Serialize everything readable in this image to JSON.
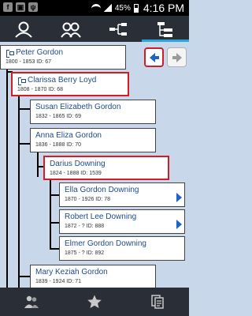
{
  "status_bar": {
    "battery": "45%",
    "time": "4:16 PM",
    "notification_icons": [
      "facebook-icon",
      "image-icon",
      "usb-icon"
    ]
  },
  "tabs": [
    {
      "icon": "person-icon",
      "active": false
    },
    {
      "icon": "family-icon",
      "active": false
    },
    {
      "icon": "pedigree-icon",
      "active": false
    },
    {
      "icon": "descendants-icon",
      "active": true
    }
  ],
  "nav": {
    "back_icon": "arrow-left-icon",
    "forward_icon": "arrow-right-icon"
  },
  "people": [
    {
      "name": "Peter Gordon",
      "meta": "1800 - 1853  ID: 67",
      "tree_icon": true,
      "selected": false,
      "expandable": false
    },
    {
      "name": "Clarissa Berry Loyd",
      "meta": "1808 - 1870  ID: 68",
      "tree_icon": true,
      "selected": true,
      "expandable": false
    },
    {
      "name": "Susan Elizabeth Gordon",
      "meta": "1832 - 1865  ID: 69",
      "tree_icon": false,
      "selected": false,
      "expandable": false
    },
    {
      "name": "Anna Eliza Gordon",
      "meta": "1836 - 1888  ID: 70",
      "tree_icon": false,
      "selected": false,
      "expandable": false
    },
    {
      "name": "Darius Downing",
      "meta": "1824 - 1888  ID: 1539",
      "tree_icon": false,
      "selected": true,
      "expandable": false
    },
    {
      "name": "Ella Gordon Downing",
      "meta": "1870 - 1926  ID: 78",
      "tree_icon": false,
      "selected": false,
      "expandable": true
    },
    {
      "name": "Robert Lee Downing",
      "meta": "1872 - ?  ID: 888",
      "tree_icon": false,
      "selected": false,
      "expandable": true
    },
    {
      "name": "Elmer Gordon Downing",
      "meta": "1875 - ?  ID: 892",
      "tree_icon": false,
      "selected": false,
      "expandable": false
    },
    {
      "name": "Mary Keziah Gordon",
      "meta": "1839 - 1924  ID: 71",
      "tree_icon": false,
      "selected": false,
      "expandable": false
    }
  ],
  "bottom_bar": [
    "people-icon",
    "star-icon",
    "documents-icon"
  ],
  "colors": {
    "accent": "#2aa6df",
    "selected_border": "#cc1f2a",
    "name_text": "#1f4c8a",
    "bars": "#2a2e36",
    "background": "#c9d7ea"
  }
}
